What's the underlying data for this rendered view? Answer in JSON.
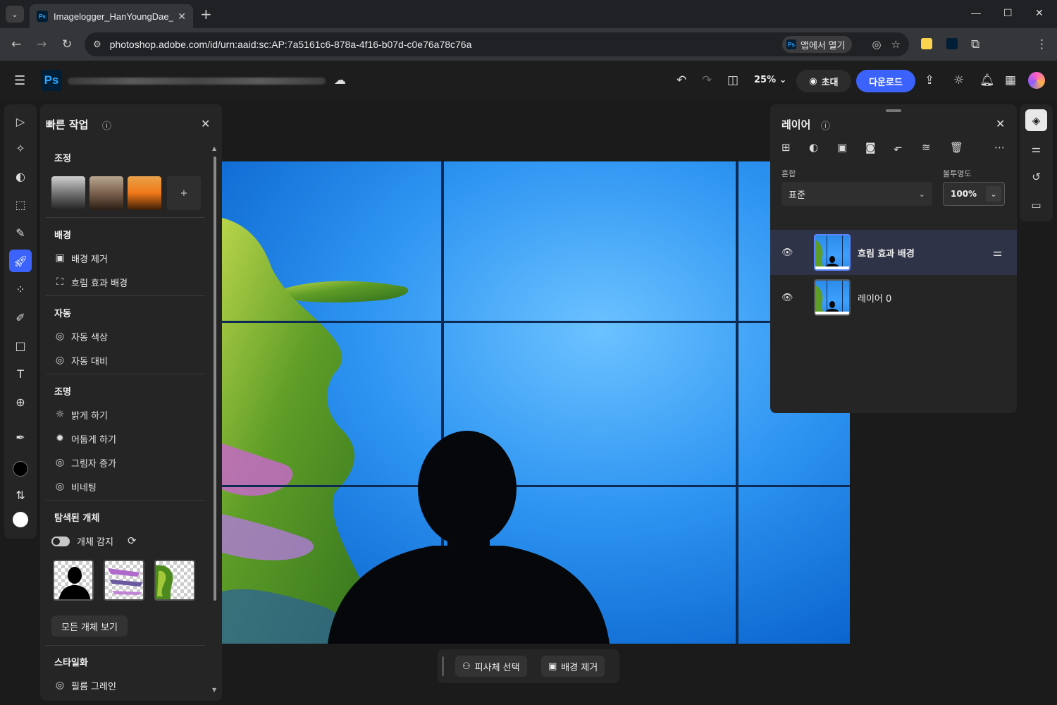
{
  "browser": {
    "tab_title": "Imagelogger_HanYoungDae_G",
    "url": "photoshop.adobe.com/id/urn:aaid:sc:AP:7a5161c6-878a-4f16-b07d-c0e76a78c76a",
    "open_in_app": "앱에서 열기",
    "favicon_text": "Ps"
  },
  "app": {
    "logo": "Ps",
    "zoom": "25%",
    "invite_label": "초대",
    "download_label": "다운로드"
  },
  "quick_actions": {
    "title": "빠른 작업",
    "sections": {
      "adjust": "조정",
      "background": "배경",
      "auto": "자동",
      "lighting": "조명",
      "detected": "탐색된 개체",
      "stylize": "스타일화"
    },
    "preset_add": "+",
    "items": {
      "remove_bg": "배경 제거",
      "blur_bg": "흐림 효과 배경",
      "auto_color": "자동 색상",
      "auto_contrast": "자동 대비",
      "brighten": "밝게 하기",
      "darken": "어둡게 하기",
      "shadow": "그림자 증가",
      "vignette": "비네팅",
      "film_grain": "필름 그레인"
    },
    "object_detect": "개체 감지",
    "object_detect_on": true,
    "view_all": "모든 개체 보기"
  },
  "canvas_bar": {
    "select_subject": "피사체 선택",
    "remove_bg": "배경 제거"
  },
  "layers": {
    "title": "레이어",
    "blend_label": "혼합",
    "blend_value": "표준",
    "opacity_label": "불투명도",
    "opacity_value": "100%",
    "items": [
      {
        "name": "흐림 효과 배경",
        "selected": true
      },
      {
        "name": "레이어 0",
        "selected": false
      }
    ]
  },
  "colors": {
    "accent": "#3b63fb",
    "foreground_swatch": "#000000",
    "background_swatch": "#ffffff"
  }
}
